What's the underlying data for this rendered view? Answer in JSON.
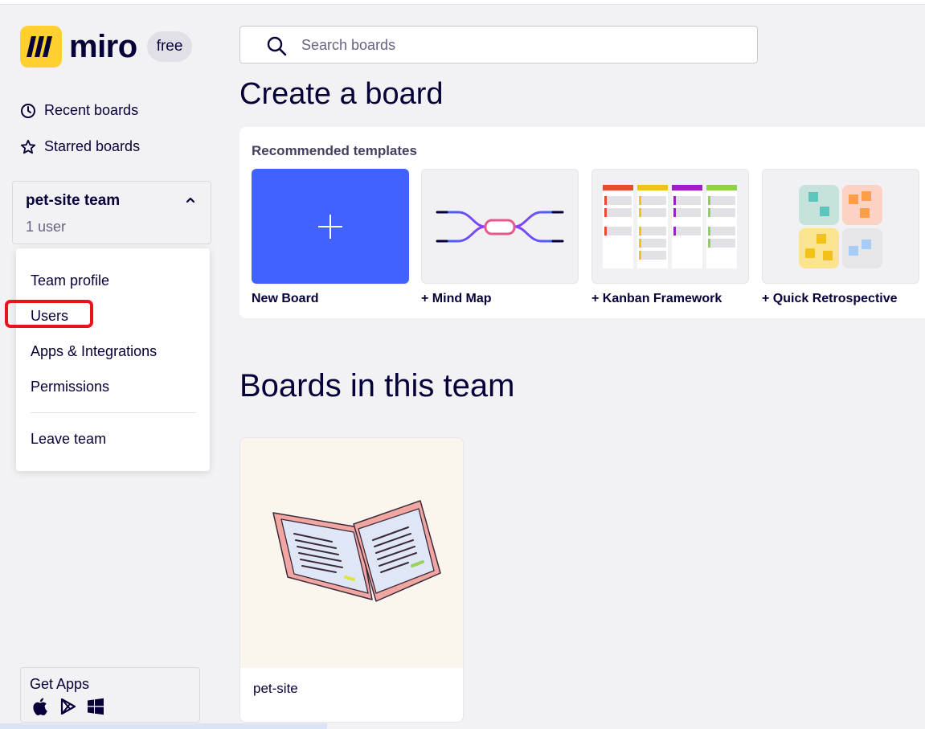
{
  "app": {
    "logo_text": "miro",
    "plan_badge": "free"
  },
  "sidebar": {
    "nav": [
      {
        "label": "Recent boards",
        "icon": "clock-icon"
      },
      {
        "label": "Starred boards",
        "icon": "star-icon"
      }
    ],
    "team": {
      "name": "pet-site team",
      "users": "1 user"
    },
    "team_menu": {
      "items": [
        "Team profile",
        "Users",
        "Apps & Integrations",
        "Permissions"
      ],
      "leave": "Leave team"
    },
    "get_apps": {
      "label": "Get Apps",
      "stores": [
        "apple-icon",
        "google-play-icon",
        "windows-icon"
      ]
    }
  },
  "search": {
    "placeholder": "Search boards"
  },
  "create": {
    "title": "Create a board",
    "templates_title": "Recommended templates",
    "templates": [
      {
        "label": "New Board"
      },
      {
        "label": "+ Mind Map"
      },
      {
        "label": "+ Kanban Framework"
      },
      {
        "label": "+ Quick Retrospective"
      }
    ]
  },
  "boards": {
    "title": "Boards in this team",
    "items": [
      {
        "name": "pet-site"
      }
    ]
  },
  "colors": {
    "accent": "#4262ff",
    "brand_yellow": "#ffd02f",
    "annotation_red": "#e8141c"
  }
}
